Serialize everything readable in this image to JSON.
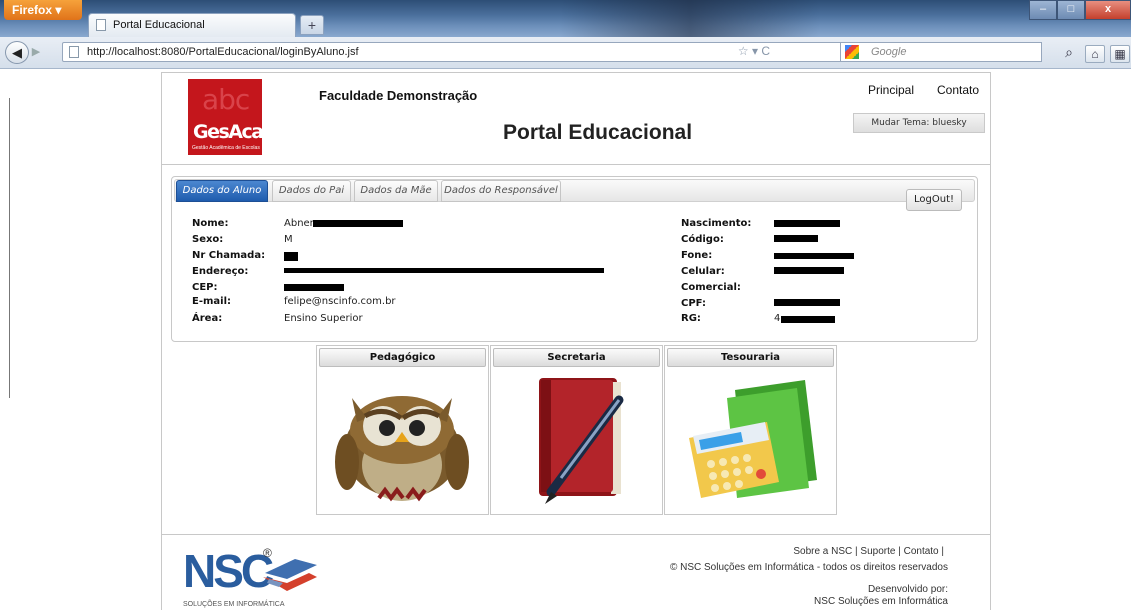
{
  "browser": {
    "app_button": "Firefox ▾",
    "tab_title": "Portal Educacional",
    "new_tab": "+",
    "url": "http://localhost:8080/PortalEducacional/loginByAluno.jsf",
    "url_icons": "☆ ▾ C",
    "search_placeholder": "Google",
    "window_buttons": {
      "minimize": "–",
      "maximize": "□",
      "close": "x"
    }
  },
  "header": {
    "logo": {
      "abc": "abc",
      "name": "GesAcad",
      "tagline": "Gestão Acadêmica de Escolas"
    },
    "institution": "Faculdade Demonstração",
    "title": "Portal Educacional",
    "links": [
      "Principal",
      "Contato"
    ],
    "theme_selector": "Mudar Tema: bluesky"
  },
  "tabs": [
    "Dados do Aluno",
    "Dados do Pai",
    "Dados da Mãe",
    "Dados do Responsável"
  ],
  "logout_label": "LogOut!",
  "student": {
    "left": [
      {
        "label": "Nome:",
        "value": "Abner"
      },
      {
        "label": "Sexo:",
        "value": "M"
      },
      {
        "label": "Nr Chamada:",
        "value": ""
      },
      {
        "label": "Endereço:",
        "value": ""
      },
      {
        "label": "CEP:",
        "value": ""
      },
      {
        "label": "E-mail:",
        "value": "felipe@nscinfo.com.br"
      },
      {
        "label": "Área:",
        "value": "Ensino Superior"
      }
    ],
    "right": [
      {
        "label": "Nascimento:",
        "value": ""
      },
      {
        "label": "Código:",
        "value": ""
      },
      {
        "label": "Fone:",
        "value": ""
      },
      {
        "label": "Celular:",
        "value": ""
      },
      {
        "label": "Comercial:",
        "value": ""
      },
      {
        "label": "CPF:",
        "value": ""
      },
      {
        "label": "RG:",
        "value": "4"
      }
    ]
  },
  "modules": [
    {
      "label": "Pedagógico",
      "icon": "owl-icon"
    },
    {
      "label": "Secretaria",
      "icon": "book-pen-icon"
    },
    {
      "label": "Tesouraria",
      "icon": "calculator-folder-icon"
    }
  ],
  "footer": {
    "logo_text": "NSC",
    "logo_registered": "®",
    "logo_tagline": "SOLUÇÕES EM INFORMÁTICA",
    "links": "Sobre a NSC |  Suporte |  Contato |",
    "copyright": "© NSC Soluções em Informática - todos os direitos reservados",
    "developed_by": "Desenvolvido por:",
    "developer": "NSC Soluções em Informática"
  },
  "colors": {
    "active_tab": "#2a6bbf",
    "logo_red": "#c4161c",
    "nsc_blue": "#2a5d9e"
  }
}
